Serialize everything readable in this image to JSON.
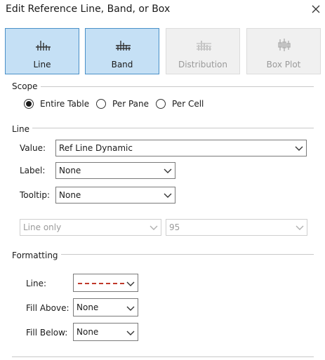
{
  "window": {
    "title": "Edit Reference Line, Band, or Box"
  },
  "types": [
    {
      "label": "Line",
      "icon": "line-chart-icon",
      "state": "active"
    },
    {
      "label": "Band",
      "icon": "band-chart-icon",
      "state": "active"
    },
    {
      "label": "Distribution",
      "icon": "distribution-chart-icon",
      "state": "disabled"
    },
    {
      "label": "Box Plot",
      "icon": "box-plot-icon",
      "state": "disabled"
    }
  ],
  "scope": {
    "heading": "Scope",
    "options": [
      {
        "label": "Entire Table",
        "checked": true
      },
      {
        "label": "Per Pane",
        "checked": false
      },
      {
        "label": "Per Cell",
        "checked": false
      }
    ]
  },
  "line": {
    "heading": "Line",
    "value_label": "Value:",
    "value": "Ref Line Dynamic",
    "label_label": "Label:",
    "label_value": "None",
    "tooltip_label": "Tooltip:",
    "tooltip_value": "None",
    "mode_value": "Line only",
    "percent_value": "95"
  },
  "formatting": {
    "heading": "Formatting",
    "line_label": "Line:",
    "line_color": "#c0392b",
    "fill_above_label": "Fill Above:",
    "fill_above_value": "None",
    "fill_below_label": "Fill Below:",
    "fill_below_value": "None"
  },
  "colors": {
    "accent_border": "#4a90c8",
    "accent_fill": "#c5e0f5"
  }
}
